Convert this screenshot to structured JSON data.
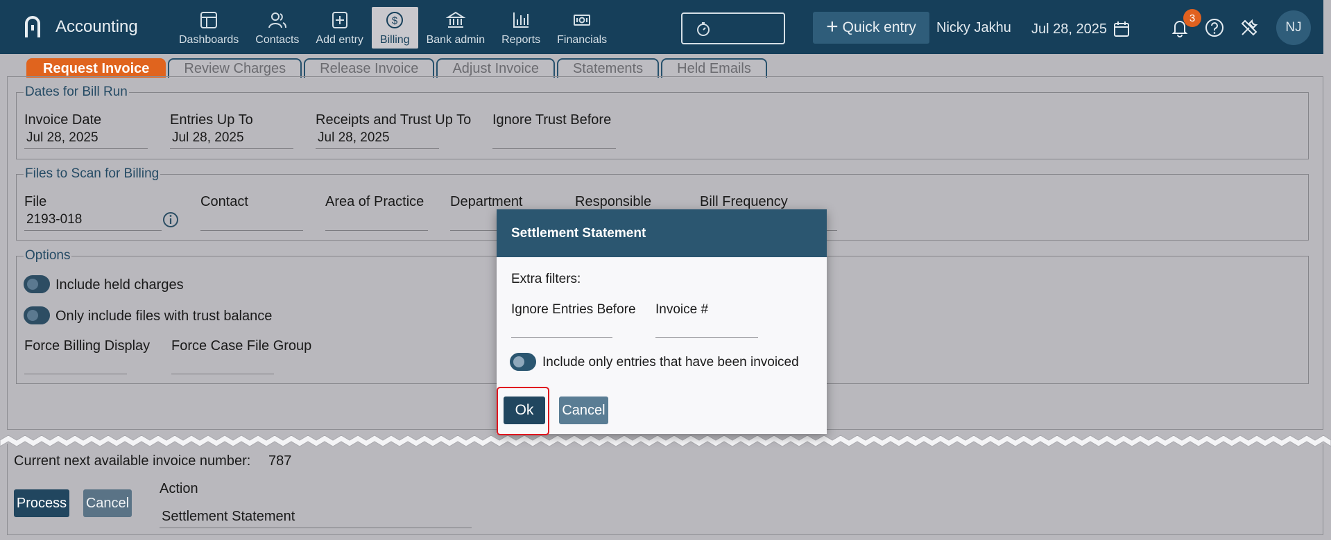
{
  "app": {
    "name": "Accounting",
    "user_name": "Nicky Jakhu",
    "date": "Jul 28, 2025",
    "notification_count": "3",
    "avatar_initials": "NJ",
    "quick_entry_label": "Quick entry",
    "timer_value": ""
  },
  "nav": {
    "items": [
      {
        "label": "Dashboards",
        "icon": "dashboard-icon"
      },
      {
        "label": "Contacts",
        "icon": "contacts-icon"
      },
      {
        "label": "Add entry",
        "icon": "add-entry-icon"
      },
      {
        "label": "Billing",
        "icon": "billing-icon",
        "active": true
      },
      {
        "label": "Bank admin",
        "icon": "bank-icon"
      },
      {
        "label": "Reports",
        "icon": "reports-icon"
      },
      {
        "label": "Financials",
        "icon": "financials-icon"
      }
    ]
  },
  "tabs": [
    {
      "label": "Request Invoice",
      "active": true
    },
    {
      "label": "Review Charges"
    },
    {
      "label": "Release Invoice"
    },
    {
      "label": "Adjust Invoice"
    },
    {
      "label": "Statements"
    },
    {
      "label": "Held Emails"
    }
  ],
  "dates_group": {
    "title": "Dates for Bill Run",
    "invoice_date_label": "Invoice Date",
    "invoice_date_value": "Jul 28, 2025",
    "entries_up_to_label": "Entries Up To",
    "entries_up_to_value": "Jul 28, 2025",
    "receipts_label": "Receipts and Trust Up To",
    "receipts_value": "Jul 28, 2025",
    "ignore_trust_label": "Ignore Trust Before",
    "ignore_trust_value": ""
  },
  "files_group": {
    "title": "Files to Scan for Billing",
    "file_label": "File",
    "file_value": "2193-018",
    "contact_label": "Contact",
    "area_label": "Area of Practice",
    "department_label": "Department",
    "responsible_label": "Responsible",
    "bill_frequency_label": "Bill Frequency"
  },
  "options_group": {
    "title": "Options",
    "include_held_label": "Include held charges",
    "trust_balance_label": "Only include files with trust balance",
    "force_billing_label": "Force Billing Display",
    "force_case_label": "Force Case File Group"
  },
  "bottom": {
    "next_invoice_label": "Current next available invoice number:",
    "next_invoice_value": "787",
    "process_label": "Process",
    "cancel_label": "Cancel",
    "action_label": "Action",
    "action_value": "Settlement Statement"
  },
  "modal": {
    "title": "Settlement Statement",
    "extra_filters_label": "Extra filters:",
    "ignore_entries_label": "Ignore Entries Before",
    "invoice_num_label": "Invoice #",
    "invoiced_only_label": "Include only entries that have been invoiced",
    "ok_label": "Ok",
    "cancel_label": "Cancel"
  },
  "colors": {
    "topbar": "#163f5a",
    "active_tab": "#e0641e",
    "modal_header": "#2b5670",
    "highlight": "#e0161f"
  }
}
